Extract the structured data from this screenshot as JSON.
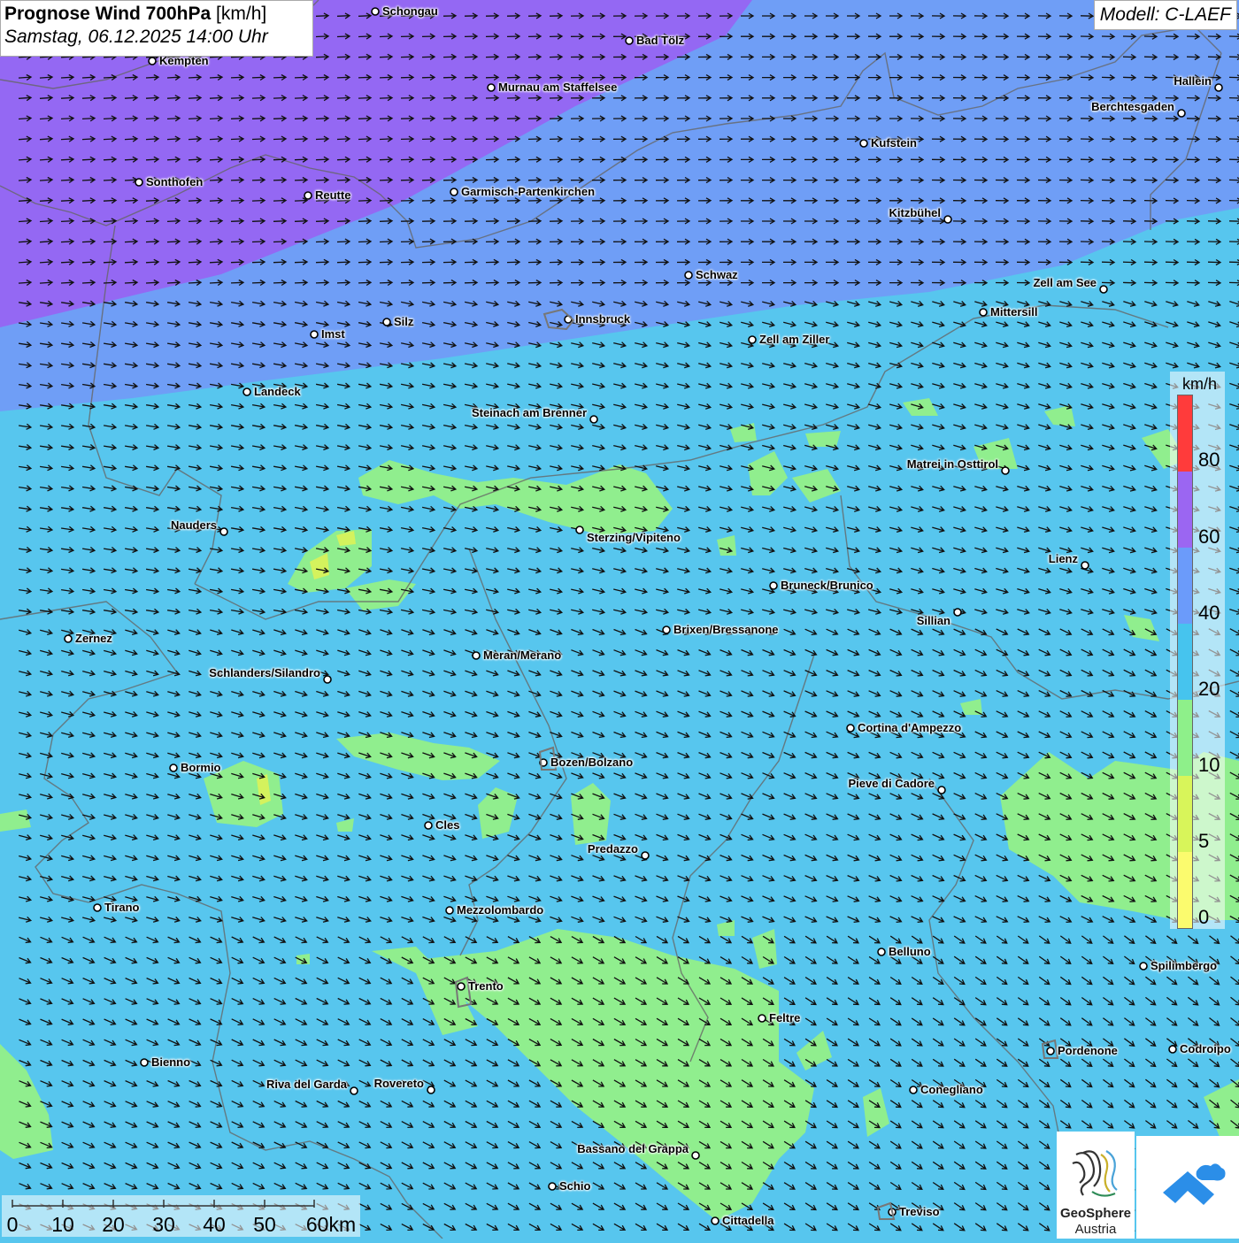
{
  "header": {
    "title_bold": "Prognose Wind 700hPa",
    "title_unit": "[km/h]",
    "datetime": "Samstag, 06.12.2025 14:00 Uhr",
    "model": "Modell: C-LAEF"
  },
  "legend": {
    "unit": "km/h",
    "labels": [
      "80",
      "60",
      "40",
      "20",
      "10",
      "5",
      "0"
    ],
    "colors": [
      "#ff3b3b",
      "#9b66f2",
      "#6b9bfa",
      "#46c4ee",
      "#8ef08a",
      "#d8f55a",
      "#fbfb6e"
    ]
  },
  "scale": {
    "labels": [
      "0",
      "10",
      "20",
      "30",
      "40",
      "50",
      "60km"
    ]
  },
  "cities": [
    {
      "name": "Schongau"
    },
    {
      "name": "Bad Tölz"
    },
    {
      "name": "Kempten"
    },
    {
      "name": "Murnau am Staffelsee"
    },
    {
      "name": "Hallein"
    },
    {
      "name": "Berchtesgaden"
    },
    {
      "name": "Kufstein"
    },
    {
      "name": "Sonthofen"
    },
    {
      "name": "Reutte"
    },
    {
      "name": "Garmisch-Partenkirchen"
    },
    {
      "name": "Kitzbühel"
    },
    {
      "name": "Schwaz"
    },
    {
      "name": "Zell am See"
    },
    {
      "name": "Innsbruck"
    },
    {
      "name": "Mittersill"
    },
    {
      "name": "Imst"
    },
    {
      "name": "Silz"
    },
    {
      "name": "Zell am Ziller"
    },
    {
      "name": "Landeck"
    },
    {
      "name": "Steinach am Brenner"
    },
    {
      "name": "Matrei in Osttirol"
    },
    {
      "name": "Nauders"
    },
    {
      "name": "Sterzing/Vipiteno"
    },
    {
      "name": "Lienz"
    },
    {
      "name": "Bruneck/Brunico"
    },
    {
      "name": "Sillian"
    },
    {
      "name": "Zernez"
    },
    {
      "name": "Brixen/Bressanone"
    },
    {
      "name": "Meran/Merano"
    },
    {
      "name": "Schlanders/Silandro"
    },
    {
      "name": "Cortina d'Ampezzo"
    },
    {
      "name": "Bozen/Bolzano"
    },
    {
      "name": "Bormio"
    },
    {
      "name": "Pieve di Cadore"
    },
    {
      "name": "Cles"
    },
    {
      "name": "Predazzo"
    },
    {
      "name": "Tirano"
    },
    {
      "name": "Mezzolombardo"
    },
    {
      "name": "Belluno"
    },
    {
      "name": "Spilimbergo"
    },
    {
      "name": "Trento"
    },
    {
      "name": "Feltre"
    },
    {
      "name": "Pordenone"
    },
    {
      "name": "Codroipo"
    },
    {
      "name": "Bienno"
    },
    {
      "name": "Riva del Garda"
    },
    {
      "name": "Rovereto"
    },
    {
      "name": "Conegliano"
    },
    {
      "name": "Bassano del Grappa"
    },
    {
      "name": "Schio"
    },
    {
      "name": "Treviso"
    },
    {
      "name": "Cittadella"
    }
  ],
  "logo": {
    "name_line1": "GeoSphere",
    "name_line2": "Austria"
  }
}
